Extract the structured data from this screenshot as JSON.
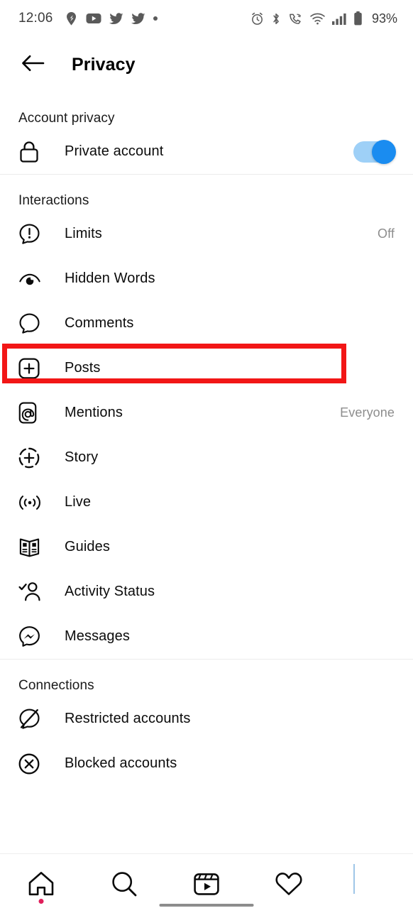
{
  "status_bar": {
    "time": "12:06",
    "battery_percent": "93%",
    "left_icons": [
      "location-pin-icon",
      "youtube-icon",
      "twitter-icon",
      "twitter-icon",
      "more-dot-icon"
    ],
    "right_icons": [
      "alarm-icon",
      "bluetooth-icon",
      "wifi-calling-icon",
      "wifi-icon",
      "cellular-signal-icon",
      "battery-icon"
    ]
  },
  "header": {
    "back_icon": "arrow-left-icon",
    "title": "Privacy"
  },
  "sections": [
    {
      "id": "account-privacy",
      "title": "Account privacy",
      "rows": [
        {
          "id": "private-account",
          "icon": "lock-icon",
          "label": "Private account",
          "control": "toggle",
          "toggle_on": true
        }
      ]
    },
    {
      "id": "interactions",
      "title": "Interactions",
      "rows": [
        {
          "id": "limits",
          "icon": "limits-bubble-exclamation-icon",
          "label": "Limits",
          "value": "Off"
        },
        {
          "id": "hidden-words",
          "icon": "eye-hidden-icon",
          "label": "Hidden Words",
          "value": "",
          "highlighted": true
        },
        {
          "id": "comments",
          "icon": "comment-bubble-icon",
          "label": "Comments",
          "value": ""
        },
        {
          "id": "posts",
          "icon": "posts-plus-square-icon",
          "label": "Posts",
          "value": ""
        },
        {
          "id": "mentions",
          "icon": "at-mention-icon",
          "label": "Mentions",
          "value": "Everyone"
        },
        {
          "id": "story",
          "icon": "story-plus-circle-icon",
          "label": "Story",
          "value": ""
        },
        {
          "id": "live",
          "icon": "live-broadcast-icon",
          "label": "Live",
          "value": ""
        },
        {
          "id": "guides",
          "icon": "guides-book-icon",
          "label": "Guides",
          "value": ""
        },
        {
          "id": "activity-status",
          "icon": "person-check-icon",
          "label": "Activity Status",
          "value": ""
        },
        {
          "id": "messages",
          "icon": "messenger-icon",
          "label": "Messages",
          "value": ""
        }
      ]
    },
    {
      "id": "connections",
      "title": "Connections",
      "rows": [
        {
          "id": "restricted-accounts",
          "icon": "restricted-bubble-slash-icon",
          "label": "Restricted accounts",
          "value": ""
        },
        {
          "id": "blocked-accounts",
          "icon": "blocked-circle-x-icon",
          "label": "Blocked accounts",
          "value": ""
        }
      ]
    }
  ],
  "annotation": {
    "target_row": "hidden-words",
    "color": "#f21616"
  },
  "bottom_nav": [
    {
      "id": "home",
      "icon": "home-icon",
      "badge": true
    },
    {
      "id": "search",
      "icon": "search-icon",
      "badge": false
    },
    {
      "id": "reels",
      "icon": "reels-icon",
      "badge": false
    },
    {
      "id": "activity",
      "icon": "heart-icon",
      "badge": false
    },
    {
      "id": "profile",
      "icon": "profile-avatar-icon",
      "badge": false
    }
  ],
  "colors": {
    "accent_blue": "#1a8cf0",
    "toggle_track": "#9ed0f7",
    "annotation_red": "#f21616",
    "badge_red": "#e01e5a",
    "text_primary": "#0b0b0b",
    "text_secondary": "#8d8d8d",
    "divider": "#ebebeb"
  }
}
